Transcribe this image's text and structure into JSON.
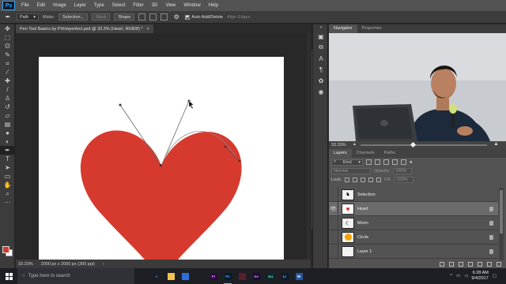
{
  "app": {
    "logo": "Ps"
  },
  "menu": [
    "File",
    "Edit",
    "Image",
    "Layer",
    "Type",
    "Select",
    "Filter",
    "3D",
    "View",
    "Window",
    "Help"
  ],
  "options": {
    "tool_icon": "pen-tool-icon",
    "mode_value": "Path",
    "make_label": "Make:",
    "selection_btn": "Selection...",
    "mask_btn": "Mask",
    "shape_btn": "Shape",
    "auto_add_delete": "Auto Add/Delete",
    "align_edges": "Align Edges"
  },
  "toolbar": {
    "tools": [
      "move-tool-icon",
      "marquee-tool-icon",
      "lasso-tool-icon",
      "quick-select-icon",
      "crop-tool-icon",
      "eyedropper-icon",
      "healing-brush-icon",
      "brush-tool-icon",
      "clone-stamp-icon",
      "history-brush-icon",
      "eraser-icon",
      "gradient-tool-icon",
      "blur-tool-icon",
      "dodge-tool-icon",
      "pen-tool-icon",
      "type-tool-icon",
      "path-select-icon",
      "shape-tool-icon",
      "hand-tool-icon",
      "zoom-tool-icon",
      "more-tools-icon"
    ],
    "foreground_color": "#d63a2e",
    "background_color": "#ffffff"
  },
  "document": {
    "tab_title": "Pen Tool Basics by PiXimperfect.psd @ 33.3% (Heart, RGB/8) *",
    "close": "×",
    "zoom": "33.33%",
    "doc_size": "2000 px x 2000 px (300 ppi)",
    "heart_color": "#d63a2e"
  },
  "side_icons": [
    "history-icon",
    "properties-icon",
    "character-icon",
    "paragraph-icon",
    "brush-settings-icon",
    "actions-icon"
  ],
  "navigator": {
    "tabs": [
      "Navigator",
      "Properties"
    ],
    "zoom": "33.33%"
  },
  "layers": {
    "tabs": [
      "Layers",
      "Channels",
      "Paths"
    ],
    "kind": "Kind",
    "blend": "Normal",
    "opacity_label": "Opacity:",
    "opacity_value": "100%",
    "lock_label": "Lock:",
    "fill_label": "Fill:",
    "fill_value": "100%",
    "items": [
      {
        "name": "Selection",
        "visible": false,
        "selected": false,
        "locked": false
      },
      {
        "name": "Heart",
        "visible": true,
        "selected": true,
        "locked": true
      },
      {
        "name": "Moon",
        "visible": false,
        "selected": false,
        "locked": true
      },
      {
        "name": "Circle",
        "visible": false,
        "selected": false,
        "locked": true
      },
      {
        "name": "Layer 1",
        "visible": false,
        "selected": false,
        "locked": true
      }
    ]
  },
  "taskbar": {
    "search_placeholder": "Type here to search",
    "apps": [
      {
        "icon": "task-view-icon",
        "label": "",
        "bg": "#1d1f24",
        "fg": "#ddd",
        "open": false
      },
      {
        "icon": "edge-icon",
        "label": "e",
        "bg": "#1d1f24",
        "fg": "#3d8ee5",
        "open": false
      },
      {
        "icon": "file-explorer-icon",
        "label": "",
        "bg": "#f2c14e",
        "fg": "#333",
        "open": false
      },
      {
        "icon": "store-icon",
        "label": "",
        "bg": "#2b6fd6",
        "fg": "#fff",
        "open": false
      },
      {
        "icon": "chrome-icon",
        "label": "",
        "bg": "#1d1f24",
        "fg": "#fff",
        "open": false
      },
      {
        "icon": "premiere-icon",
        "label": "Pr",
        "bg": "#2a0a3a",
        "fg": "#e77bff",
        "open": false
      },
      {
        "icon": "photoshop-icon",
        "label": "Ps",
        "bg": "#0b1a2c",
        "fg": "#31a8ff",
        "open": true
      },
      {
        "icon": "video-icon",
        "label": "",
        "bg": "#5a1f2d",
        "fg": "#fff",
        "open": false
      },
      {
        "icon": "after-effects-icon",
        "label": "Ae",
        "bg": "#1f0a3a",
        "fg": "#c7a1ff",
        "open": false
      },
      {
        "icon": "audition-icon",
        "label": "Au",
        "bg": "#0c2a2a",
        "fg": "#5ff7d6",
        "open": false
      },
      {
        "icon": "lightroom-icon",
        "label": "Lr",
        "bg": "#0b1a2c",
        "fg": "#6fc6ff",
        "open": false
      },
      {
        "icon": "word-icon",
        "label": "W",
        "bg": "#2b579a",
        "fg": "#fff",
        "open": false
      }
    ],
    "time": "6:28 AM",
    "date": "9/4/2017"
  }
}
